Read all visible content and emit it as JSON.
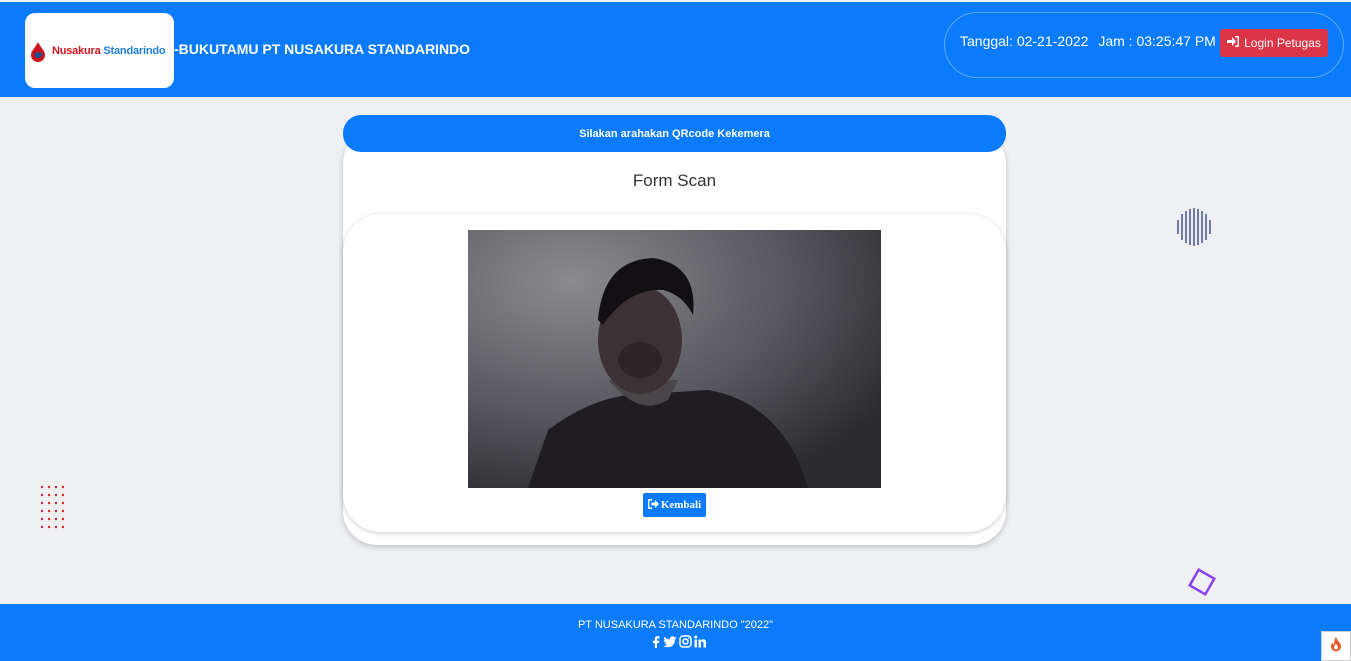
{
  "header": {
    "logo_red": "Nusakura",
    "logo_blue": "Standarindo",
    "title": "-BUKUTAMU PT NUSAKURA STANDARINDO",
    "date_text": "Tanggal: 02-21-2022",
    "time_text": "Jam : 03:25:47 PM",
    "login_label": "Login Petugas"
  },
  "main": {
    "banner": "Silakan arahakan QRcode Kekemera",
    "form_title": "Form Scan",
    "back_label": "Kembali"
  },
  "footer": {
    "copyright": "PT NUSAKURA STANDARINDO \"2022\"",
    "social_icons": [
      "facebook-icon",
      "twitter-icon",
      "instagram-icon",
      "linkedin-icon"
    ]
  },
  "colors": {
    "primary": "#0a7bfc",
    "danger": "#dc3545",
    "background": "#eef0f4"
  }
}
